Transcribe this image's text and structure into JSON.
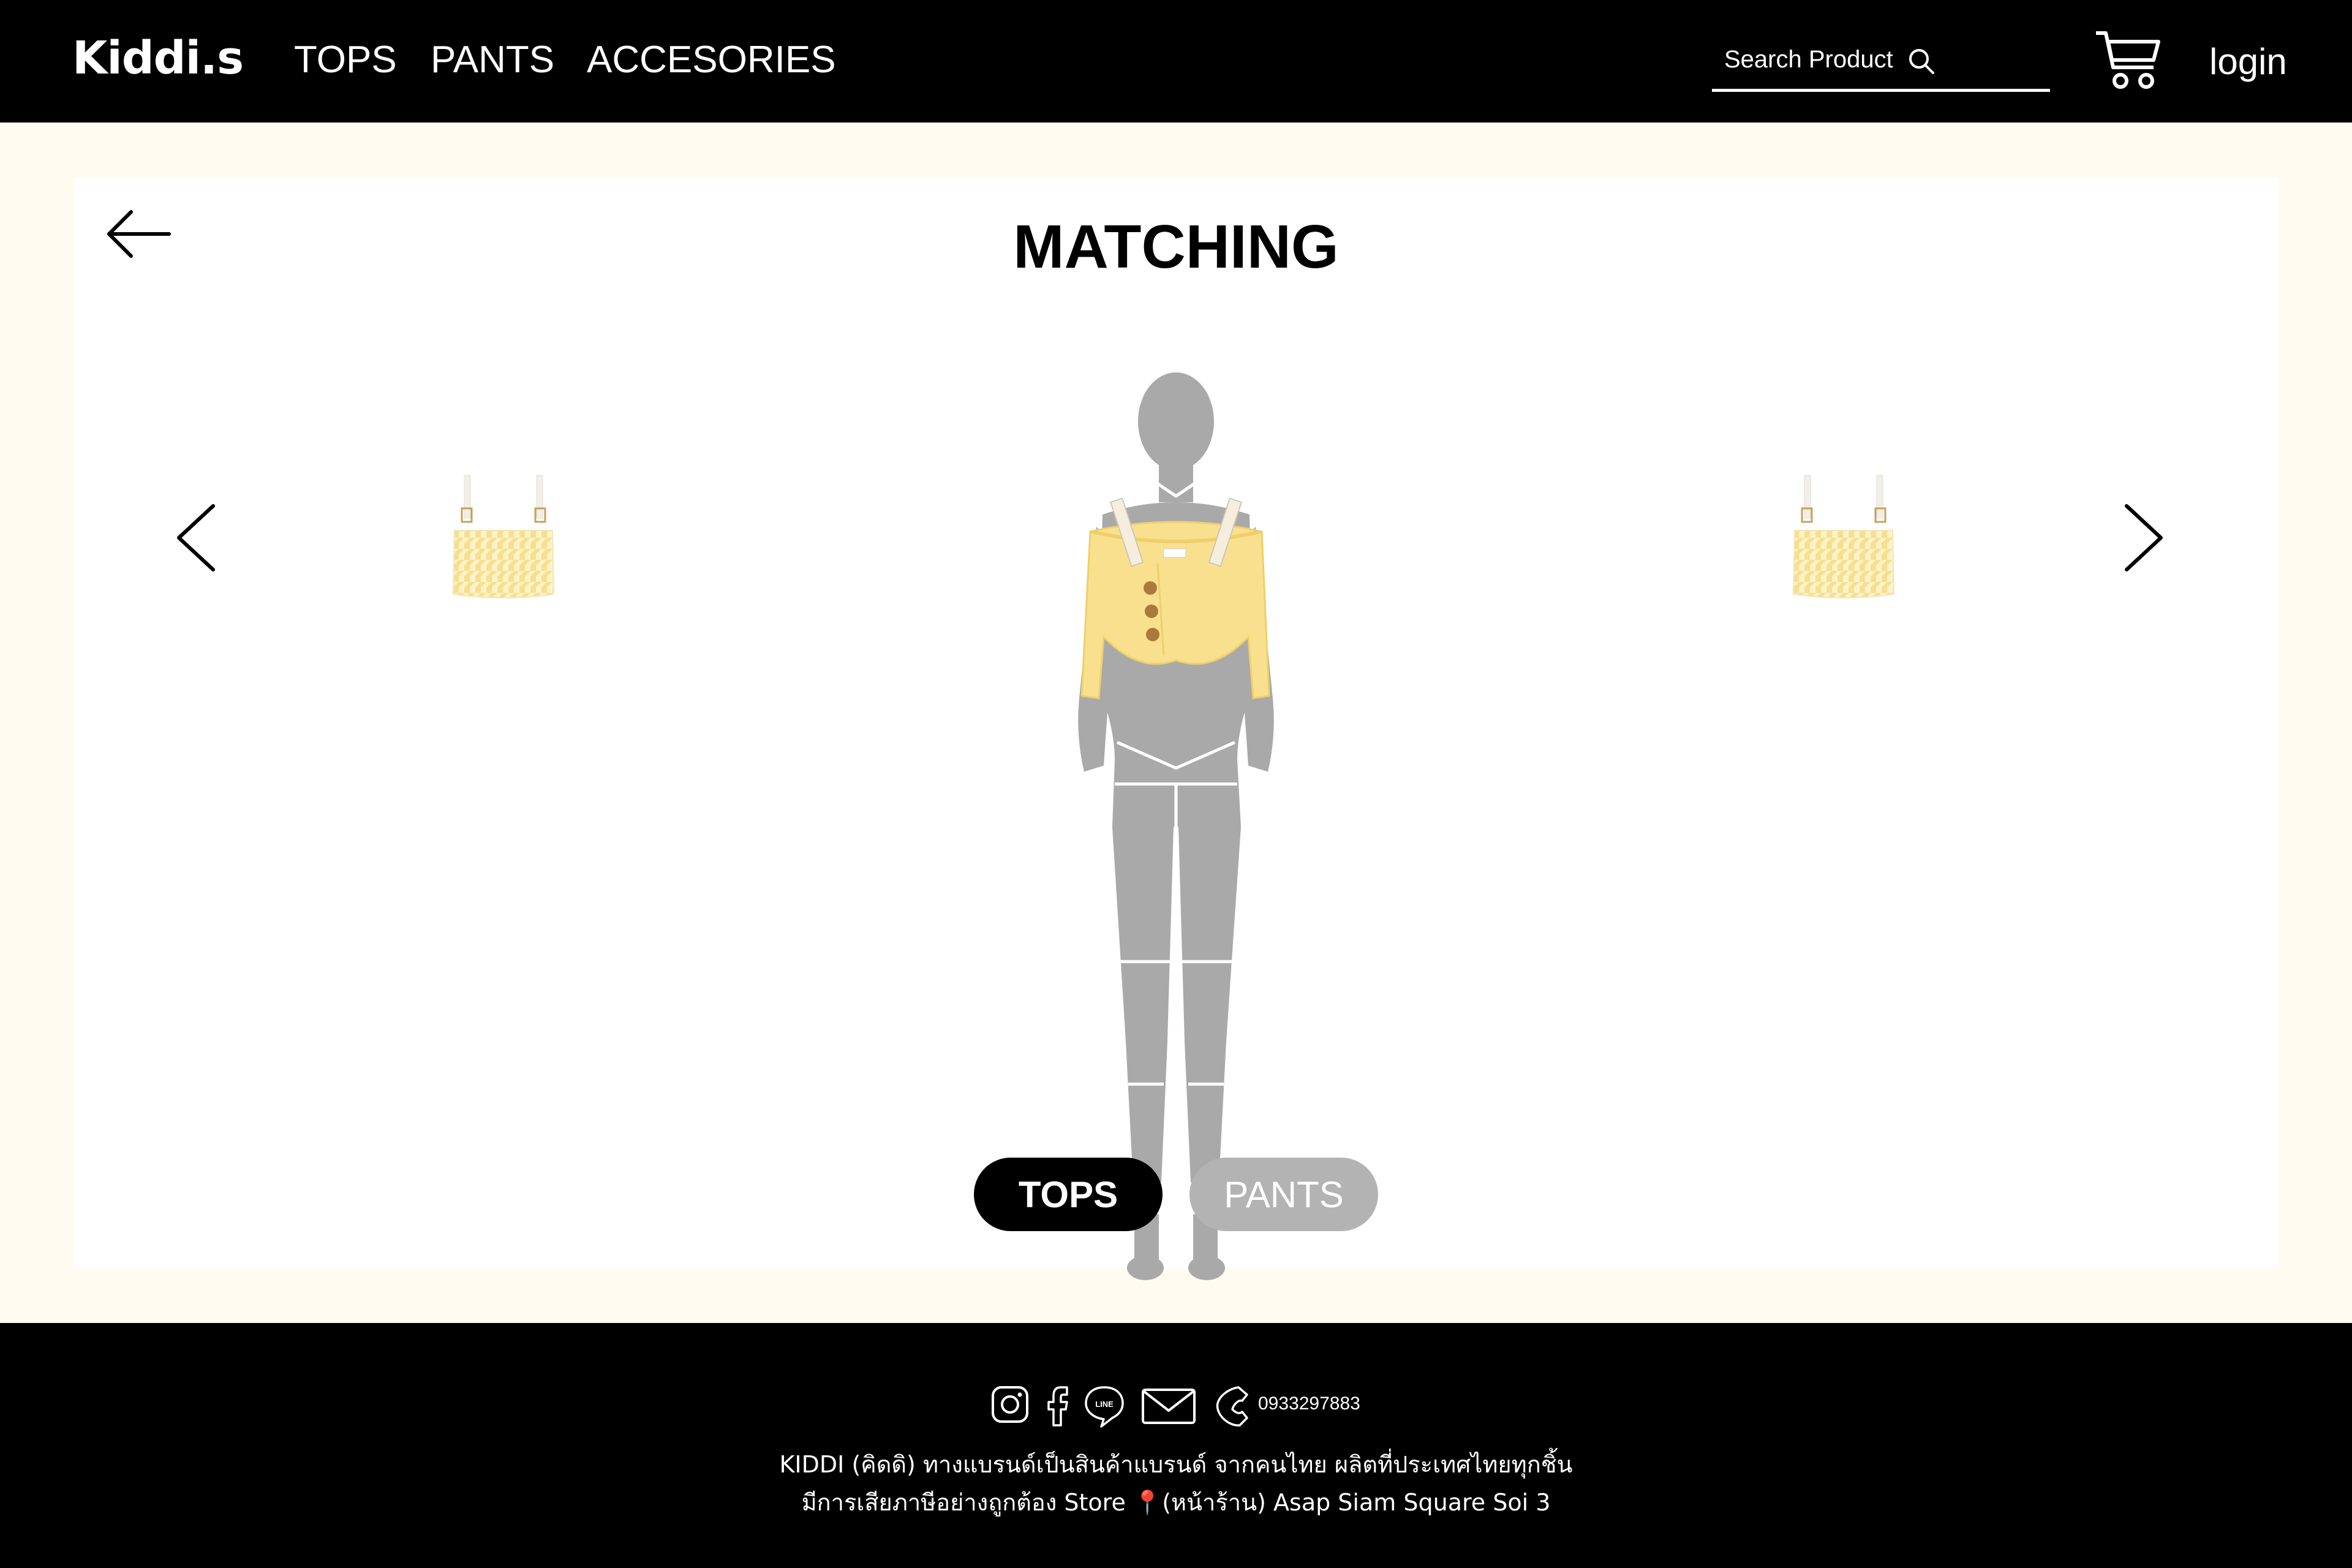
{
  "header": {
    "logo": "Kiddi.s",
    "nav": [
      "TOPS",
      "PANTS",
      "ACCESORIES"
    ],
    "search_placeholder": "Search Product",
    "login": "login",
    "icons": [
      "search-icon",
      "cart-icon"
    ]
  },
  "main": {
    "title": "MATCHING",
    "tabs": [
      {
        "label": "TOPS",
        "active": true
      },
      {
        "label": "PANTS",
        "active": false
      }
    ],
    "accent_color": "#f9e08e",
    "icons": [
      "back-arrow-icon",
      "chevron-left-icon",
      "chevron-right-icon"
    ]
  },
  "footer": {
    "phone": "0933297883",
    "line1": "KIDDI (คิดดิ) ทางแบรนด์เป็นสินค้าแบรนด์ จากคนไทย ผลิตที่ประเทศไทยทุกชิ้น",
    "line2": "มีการเสียภาษีอย่างถูกต้อง Store 📍(หน้าร้าน) Asap Siam Square Soi 3",
    "icons": [
      "instagram-icon",
      "facebook-icon",
      "line-icon",
      "mail-icon",
      "phone-icon"
    ]
  }
}
